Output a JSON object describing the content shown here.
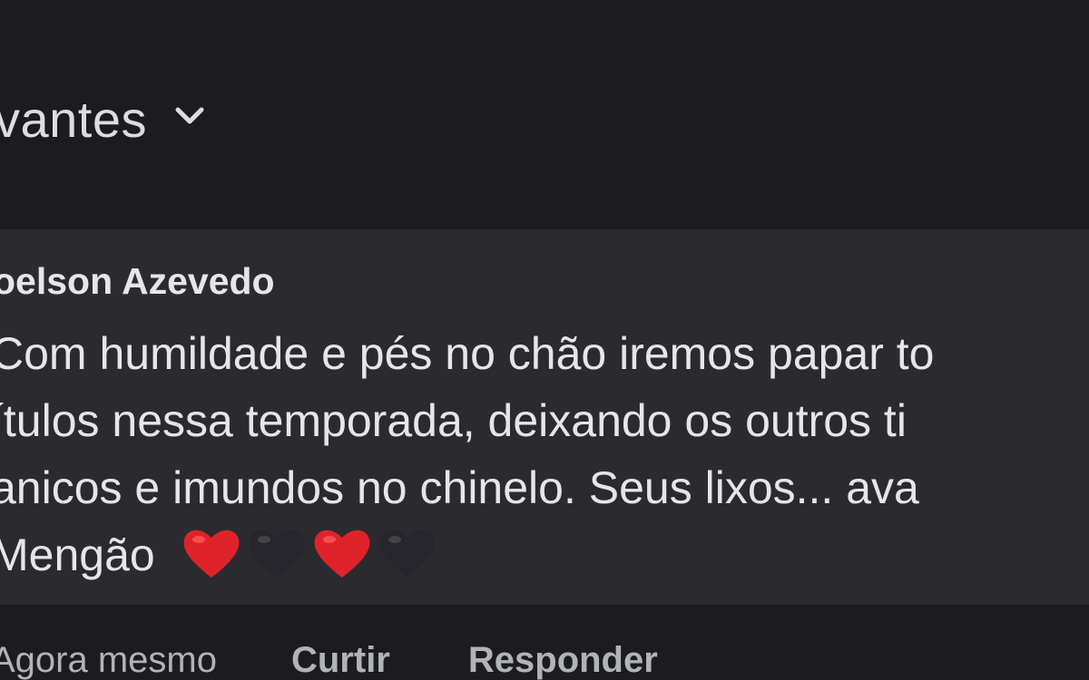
{
  "sort": {
    "label": "vantes",
    "icon": "chevron-down-icon"
  },
  "comment": {
    "author": "oelson Azevedo",
    "lines": [
      "Com humildade e pés no chão iremos papar to",
      "ítulos nessa temporada, deixando os outros ti",
      "anicos e imundos no chinelo. Seus lixos... ava"
    ],
    "last_line_text": "Mengão",
    "emojis": [
      {
        "name": "red-heart-icon",
        "color": "#e0232a"
      },
      {
        "name": "black-heart-icon",
        "color": "#2a2a30"
      },
      {
        "name": "red-heart-icon",
        "color": "#e0232a"
      },
      {
        "name": "black-heart-icon",
        "color": "#2a2a30"
      }
    ]
  },
  "actions": {
    "timestamp": "Agora mesmo",
    "like_label": "Curtir",
    "reply_label": "Responder"
  }
}
